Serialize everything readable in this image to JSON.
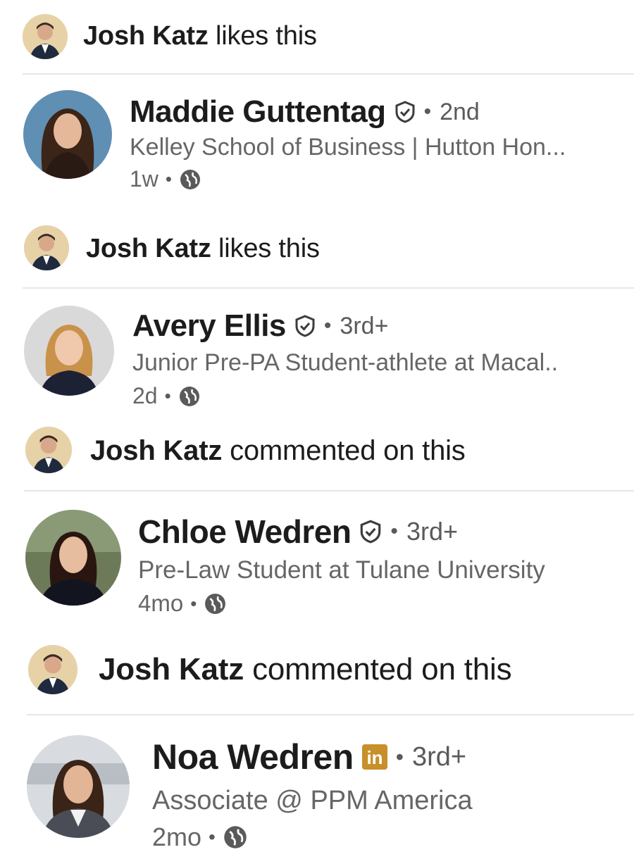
{
  "feed": [
    {
      "actor": {
        "name": "Josh Katz",
        "action": "likes this"
      },
      "author": {
        "name": "Maddie Guttentag",
        "badge": "verified-shield-icon",
        "degree": "2nd",
        "headline": "Kelley School of Business | Hutton Hon...",
        "time": "1w"
      }
    },
    {
      "actor": {
        "name": "Josh Katz",
        "action": "likes this"
      },
      "author": {
        "name": "Avery Ellis",
        "badge": "verified-shield-icon",
        "degree": "3rd+",
        "headline": "Junior Pre-PA Student-athlete at Macal..",
        "time": "2d"
      }
    },
    {
      "actor": {
        "name": "Josh Katz",
        "action": "commented on this"
      },
      "author": {
        "name": "Chloe Wedren",
        "badge": "verified-shield-icon",
        "degree": "3rd+",
        "headline": "Pre-Law Student at Tulane University",
        "time": "4mo"
      }
    },
    {
      "actor": {
        "name": "Josh Katz",
        "action": "commented on this"
      },
      "author": {
        "name": "Noa Wedren",
        "badge": "premium-in-icon",
        "badge_text": "in",
        "degree": "3rd+",
        "headline": "Associate @ PPM America",
        "time": "2mo"
      }
    }
  ],
  "separator": "•",
  "colors": {
    "premium_gold": "#c8902a",
    "muted_text": "#666666"
  }
}
